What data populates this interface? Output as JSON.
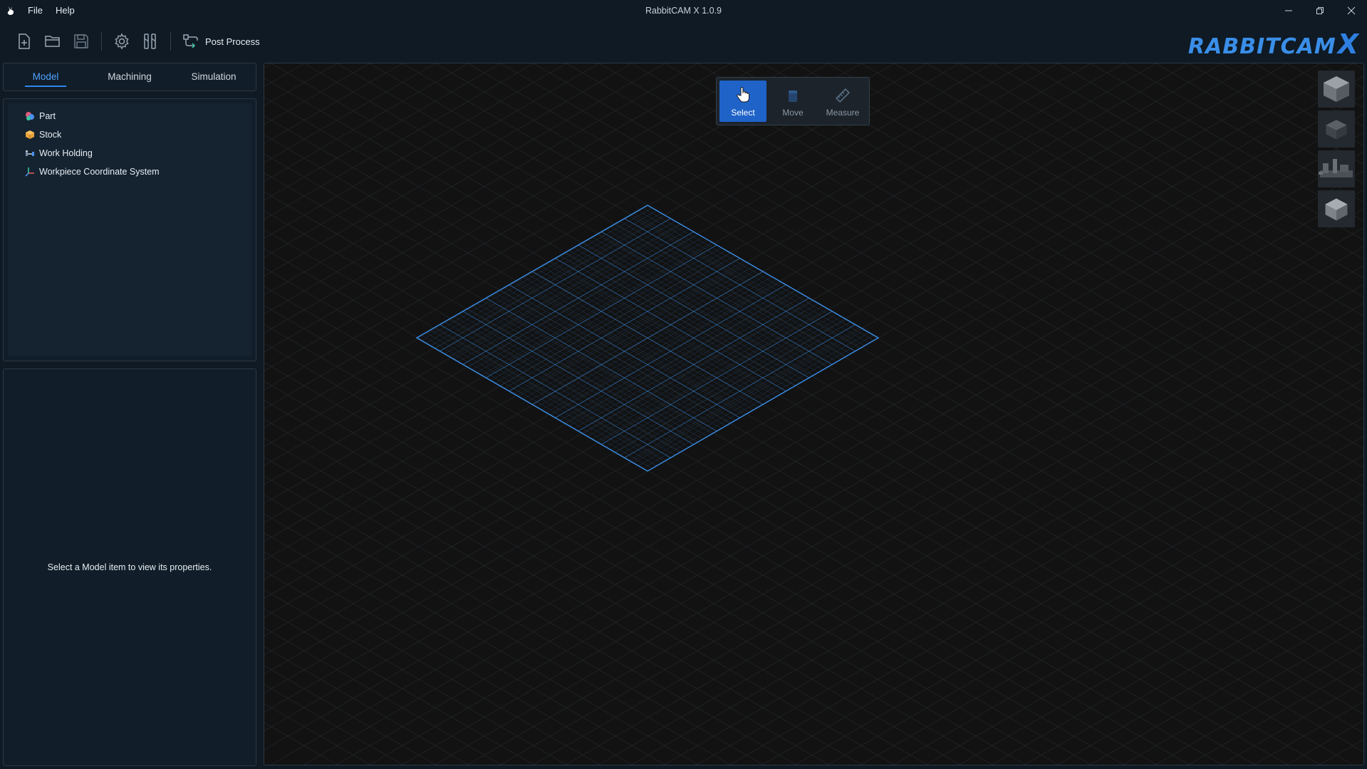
{
  "window": {
    "title": "RabbitCAM X 1.0.9",
    "menu": [
      "File",
      "Help"
    ]
  },
  "toolbar": {
    "post_process_label": "Post Process"
  },
  "brand": {
    "text": "RABBITCAM",
    "x": "X"
  },
  "tabs": [
    {
      "label": "Model",
      "active": true
    },
    {
      "label": "Machining",
      "active": false
    },
    {
      "label": "Simulation",
      "active": false
    }
  ],
  "tree": {
    "items": [
      {
        "label": "Part",
        "icon": "part-icon"
      },
      {
        "label": "Stock",
        "icon": "stock-icon"
      },
      {
        "label": "Work Holding",
        "icon": "work-holding-icon"
      },
      {
        "label": "Workpiece Coordinate System",
        "icon": "coordinate-system-icon"
      }
    ]
  },
  "properties": {
    "message": "Select a Model item to view its properties."
  },
  "modes": [
    {
      "label": "Select",
      "active": true
    },
    {
      "label": "Move",
      "active": false
    },
    {
      "label": "Measure",
      "active": false
    }
  ],
  "colors": {
    "accent": "#1f63c9",
    "grid_line": "#3a8ee8",
    "background": "#0f1a24",
    "viewport": "#121212"
  }
}
